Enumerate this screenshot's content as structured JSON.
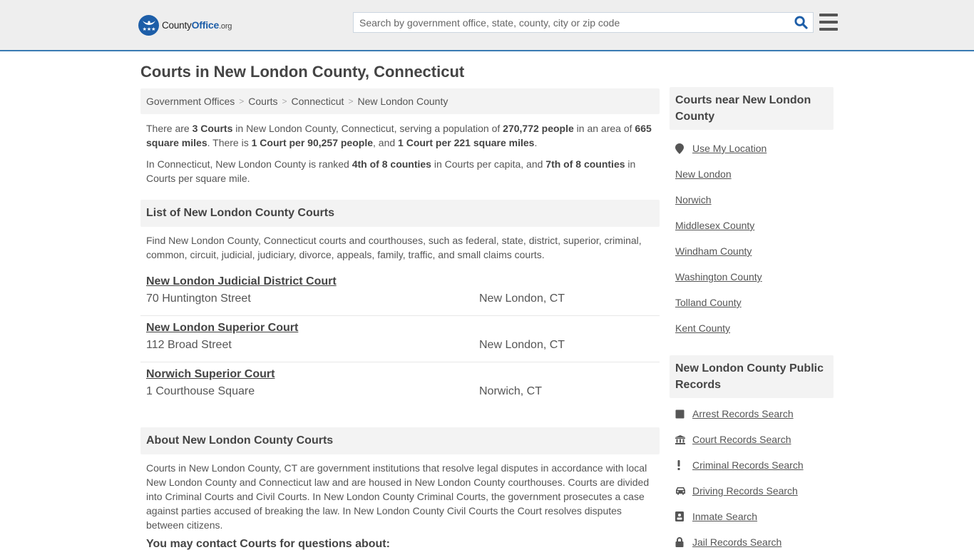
{
  "header": {
    "logo": {
      "name_part1": "County",
      "name_part2": "Office",
      "name_part3": ".org"
    },
    "search": {
      "placeholder": "Search by government office, state, county, city or zip code",
      "value": "",
      "icon": "search-icon"
    },
    "menu_icon": "hamburger-menu-icon",
    "accent_color": "#3a7bb3",
    "brand_color": "#1d5ea8"
  },
  "page": {
    "title": "Courts in New London County, Connecticut"
  },
  "breadcrumb": [
    {
      "label": "Government Offices"
    },
    {
      "label": "Courts"
    },
    {
      "label": "Connecticut"
    },
    {
      "label": "New London County"
    }
  ],
  "summary": {
    "p1": {
      "t1": "There are ",
      "b1": "3 Courts",
      "t2": " in New London County, Connecticut, serving a population of ",
      "b2": "270,772 people",
      "t3": " in an area of ",
      "b3": "665 square miles",
      "t4": ". There is ",
      "b4": "1 Court per 90,257 people",
      "t5": ", and ",
      "b5": "1 Court per 221 square miles",
      "t6": "."
    },
    "p2": {
      "t1": "In Connecticut, New London County is ranked ",
      "b1": "4th of 8 counties",
      "t2": " in Courts per capita, and ",
      "b2": "7th of 8 counties",
      "t3": " in Courts per square mile."
    }
  },
  "list_section": {
    "heading": "List of New London County Courts",
    "intro": "Find New London County, Connecticut courts and courthouses, such as federal, state, district, superior, criminal, common, circuit, judicial, judiciary, divorce, appeals, family, traffic, and small claims courts.",
    "courts": [
      {
        "name": "New London Judicial District Court",
        "address": "70 Huntington Street",
        "city": "New London, CT"
      },
      {
        "name": "New London Superior Court",
        "address": "112 Broad Street",
        "city": "New London, CT"
      },
      {
        "name": "Norwich Superior Court",
        "address": "1 Courthouse Square",
        "city": "Norwich, CT"
      }
    ]
  },
  "about_section": {
    "heading": "About New London County Courts",
    "body": "Courts in New London County, CT are government institutions that resolve legal disputes in accordance with local New London County and Connecticut law and are housed in New London County courthouses. Courts are divided into Criminal Courts and Civil Courts. In New London County Criminal Courts, the government prosecutes a case against parties accused of breaking the law. In New London County Civil Courts the Court resolves disputes between citizens.",
    "subheading": "You may contact Courts for questions about:"
  },
  "sidebar": {
    "nearby": {
      "heading": "Courts near New London County",
      "use_location": {
        "label": "Use My Location",
        "icon": "map-marker-icon"
      },
      "links": [
        {
          "label": "New London"
        },
        {
          "label": "Norwich"
        },
        {
          "label": "Middlesex County"
        },
        {
          "label": "Windham County"
        },
        {
          "label": "Washington County"
        },
        {
          "label": "Tolland County"
        },
        {
          "label": "Kent County"
        }
      ]
    },
    "records": {
      "heading": "New London County Public Records",
      "links": [
        {
          "label": "Arrest Records Search",
          "icon": "square-icon"
        },
        {
          "label": "Court Records Search",
          "icon": "courthouse-icon"
        },
        {
          "label": "Criminal Records Search",
          "icon": "exclamation-icon"
        },
        {
          "label": "Driving Records Search",
          "icon": "car-icon"
        },
        {
          "label": "Inmate Search",
          "icon": "id-badge-icon"
        },
        {
          "label": "Jail Records Search",
          "icon": "lock-icon"
        }
      ]
    }
  }
}
